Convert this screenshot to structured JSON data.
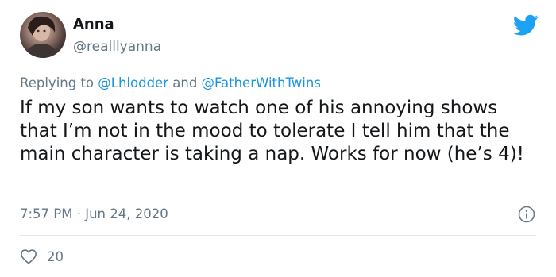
{
  "author": {
    "name": "Anna",
    "handle": "@realllyanna"
  },
  "reply_context": {
    "prefix": "Replying to ",
    "mentions": [
      "@Lhlodder",
      "@FatherWithTwins"
    ],
    "joiner": " and "
  },
  "tweet": {
    "text": "If my son wants to watch one of his annoying shows that I’m not in the mood to tolerate I tell him that the main character is taking a nap. Works for now (he’s 4)!",
    "timestamp": "7:57 PM · Jun 24, 2020"
  },
  "engagement": {
    "likes": "20"
  },
  "icons": {
    "brand": "twitter-bird-icon",
    "info": "info-icon",
    "like": "heart-icon"
  },
  "colors": {
    "brand_blue": "#1da1f2",
    "mention_blue": "#1b95e0",
    "secondary_text": "#657786",
    "primary_text": "#14171a",
    "divider": "#e1e8ed"
  }
}
